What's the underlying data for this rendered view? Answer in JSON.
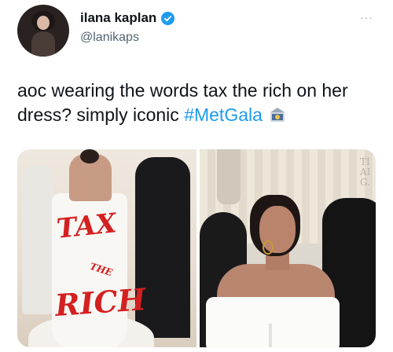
{
  "tweet": {
    "author": {
      "display_name": "ilana kaplan",
      "handle": "@lanikaps",
      "verified": true
    },
    "more_label": "···",
    "text_plain": "aoc wearing the words tax the rich on her dress? simply iconic ",
    "hashtag": "#MetGala",
    "hashtag_icon": "met-gala-emoji-icon"
  },
  "media": {
    "left_photo": {
      "dress_text": {
        "line1": "TAX",
        "line2": "THE",
        "line3": "RICH"
      }
    },
    "right_photo": {
      "background_sign": "TI\nAI\nG."
    }
  },
  "colors": {
    "link_blue": "#1d9bf0",
    "text_primary": "#0f1419",
    "text_secondary": "#536471",
    "dress_red": "#d32020"
  }
}
